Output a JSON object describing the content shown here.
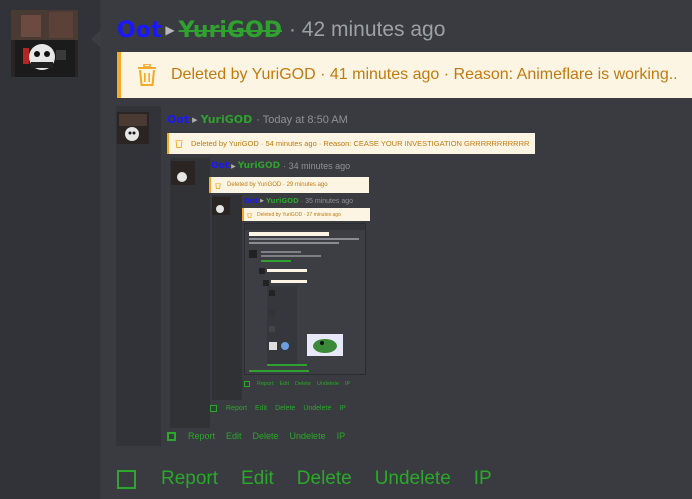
{
  "post": {
    "author": "Oot",
    "deleter": "YuriGOD",
    "time": "· 42 minutes ago",
    "deleted_notice": "Deleted by YuriGOD · 41 minutes ago · Reason: Animeflare is working.."
  },
  "quote1": {
    "author": "Oot",
    "deleter": "YuriGOD",
    "time": "· Today at 8:50 AM",
    "deleted_notice": "Deleted by YuriGOD · 54 minutes ago · Reason: CEASE YOUR INVESTIGATION GRRRRRRRRRRR"
  },
  "quote2": {
    "author": "Oot",
    "deleter": "YuriGOD",
    "time": "· 34 minutes ago",
    "deleted_notice": "Deleted by YuriGOD · 29 minutes ago"
  },
  "quote3": {
    "author": "Oot",
    "deleter": "YuriGOD",
    "time": "· 35 minutes ago",
    "deleted_notice": "Deleted by YuriGOD · 27 minutes ago"
  },
  "actions": {
    "report": "Report",
    "edit": "Edit",
    "delete": "Delete",
    "undelete": "Undelete",
    "ip": "IP"
  },
  "colors": {
    "author": "#1a17ff",
    "deleter": "#2fa12f",
    "deleted_bg": "#fcf5e3",
    "deleted_text": "#c27a10",
    "action": "#2aa82a"
  },
  "icons": {
    "deleted": "trash-icon",
    "select": "checkbox-icon"
  }
}
